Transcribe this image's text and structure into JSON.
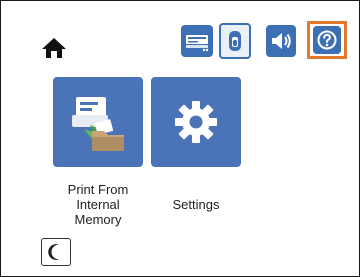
{
  "home": {
    "icon": "home-icon"
  },
  "status_bar": {
    "items": [
      {
        "name": "scanner-status-icon"
      },
      {
        "name": "ink-status-icon"
      },
      {
        "name": "sound-icon"
      },
      {
        "name": "help-icon"
      }
    ]
  },
  "tiles": [
    {
      "label_lines": [
        "Print From",
        "Internal",
        "Memory"
      ],
      "icon": "print-from-memory-icon"
    },
    {
      "label": "Settings",
      "icon": "gear-icon"
    }
  ],
  "sleep": {
    "icon": "moon-icon"
  },
  "colors": {
    "tile": "#4a73b8",
    "status": "#3d6fb5",
    "help_highlight": "#e07a2e"
  }
}
